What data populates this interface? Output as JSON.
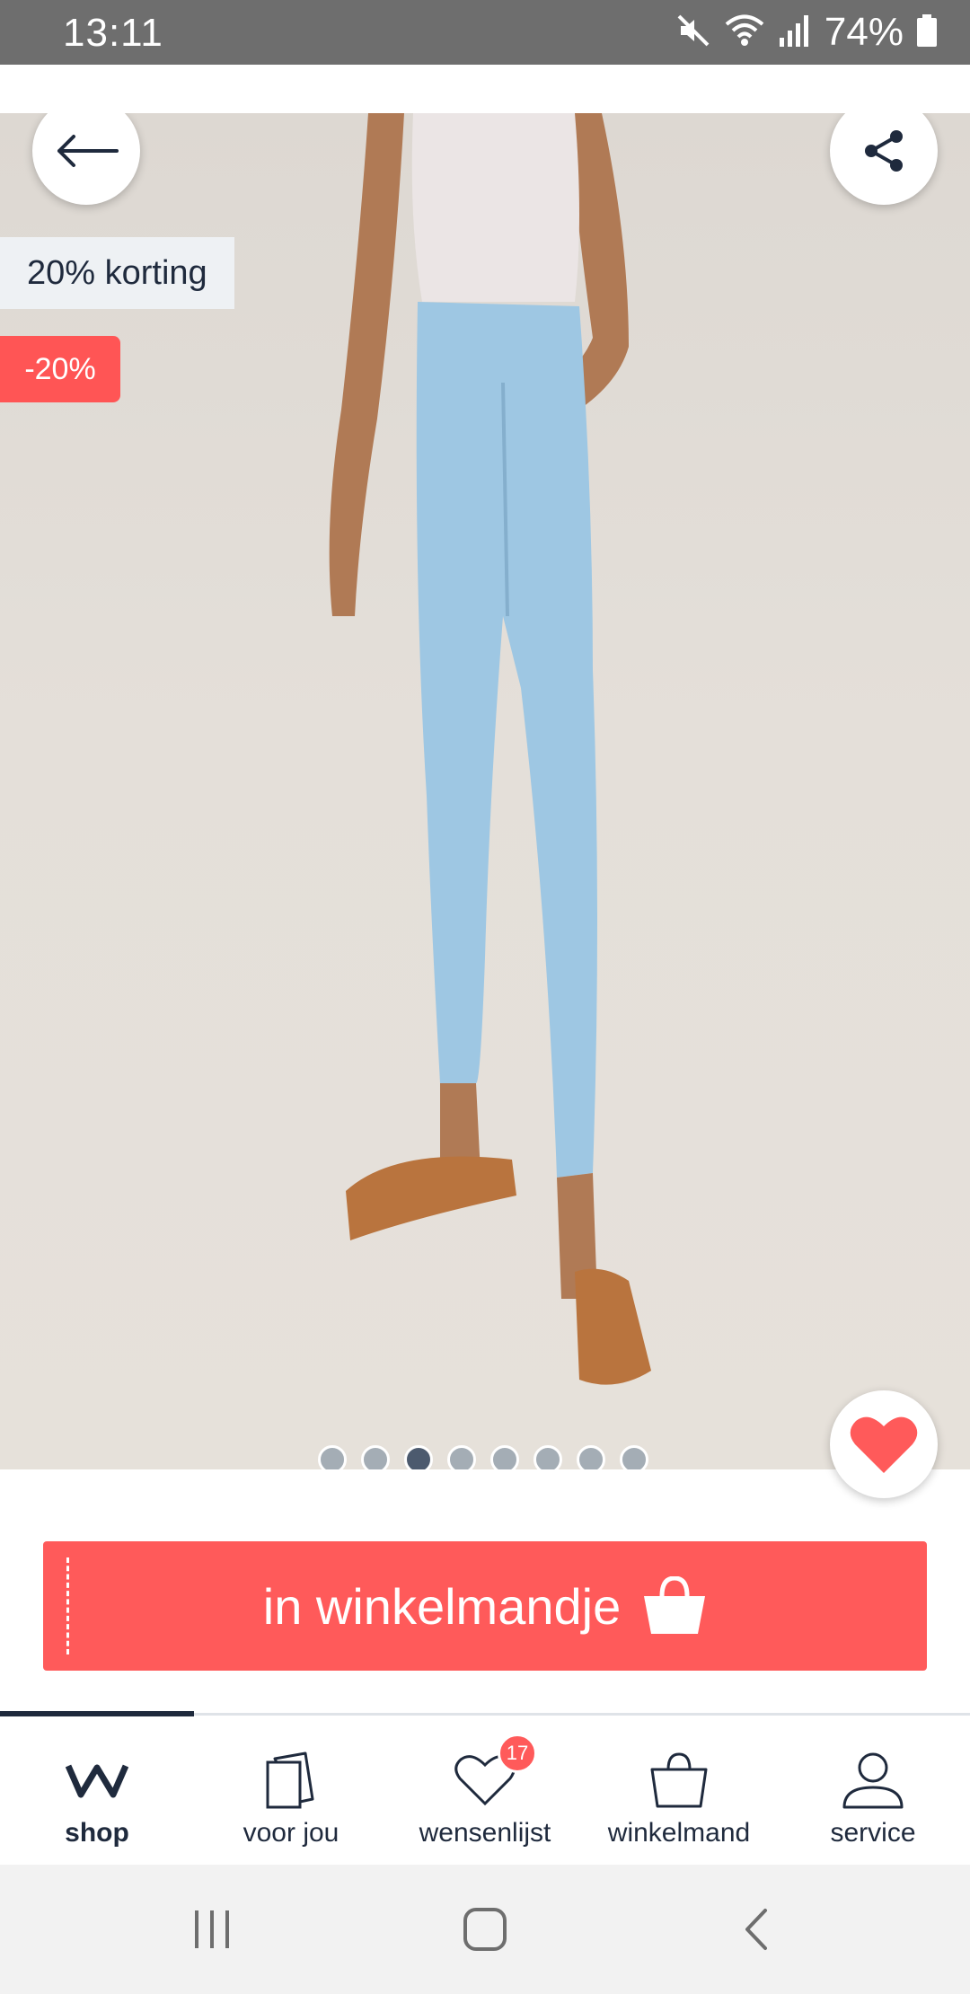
{
  "status_bar": {
    "time": "13:11",
    "battery": "74%",
    "icons": [
      "mute-icon",
      "wifi-icon",
      "signal-icon",
      "battery-icon"
    ]
  },
  "product": {
    "promo_label": "20% korting",
    "discount_badge": "-20%",
    "image_count": 8,
    "active_image_index": 2,
    "image_description_icon": "jeans-photo"
  },
  "actions": {
    "back_icon": "arrow-left-icon",
    "share_icon": "share-icon",
    "favorite_icon": "heart-icon",
    "add_to_cart_label": "in winkelmandje",
    "add_to_cart_icon": "shopping-bag-icon"
  },
  "bottom_nav": {
    "items": [
      {
        "label": "shop",
        "icon": "w-logo-icon",
        "active": true
      },
      {
        "label": "voor jou",
        "icon": "cards-icon",
        "active": false
      },
      {
        "label": "wensenlijst",
        "icon": "heart-outline-icon",
        "active": false,
        "badge": "17"
      },
      {
        "label": "winkelmand",
        "icon": "bag-outline-icon",
        "active": false
      },
      {
        "label": "service",
        "icon": "person-icon",
        "active": false
      }
    ]
  },
  "colors": {
    "accent": "#ff5a5a",
    "navy": "#1f2a3d",
    "status_bar": "#6e6e6e",
    "promo_bg": "#eef1f4"
  }
}
